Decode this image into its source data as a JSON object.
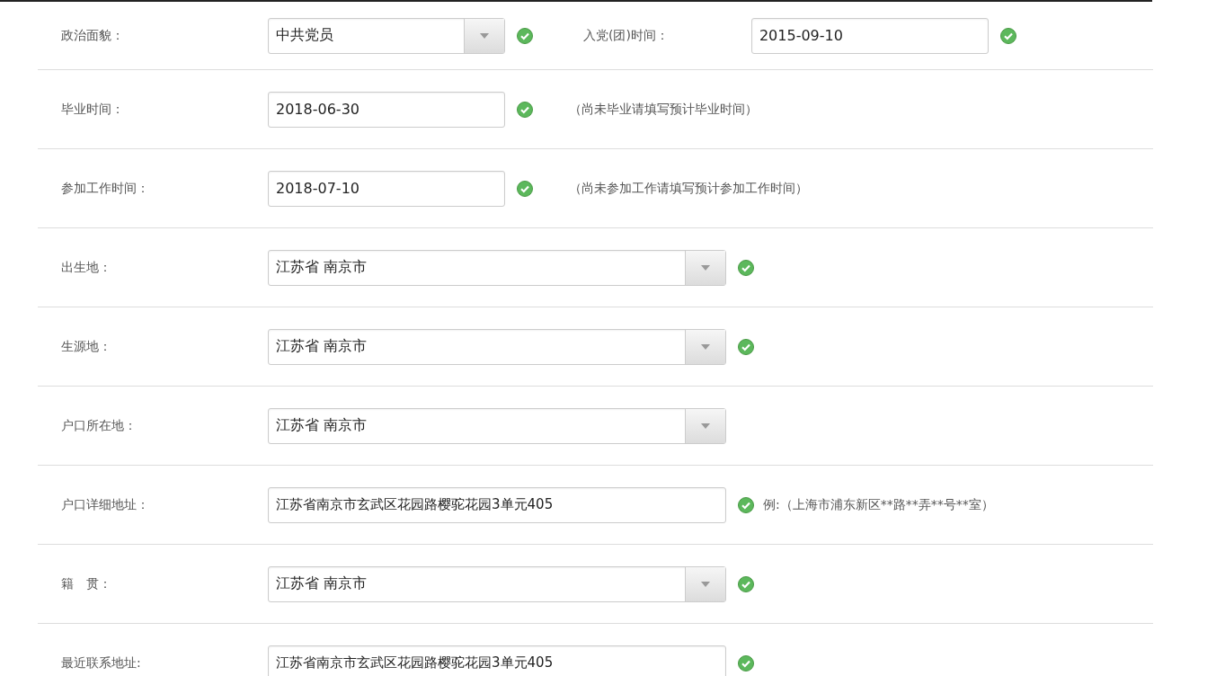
{
  "rows": [
    {
      "fields": [
        {
          "label": "政治面貌：",
          "kind": "select",
          "value": "中共党员",
          "valid": true
        },
        {
          "label": "入党(团)时间：",
          "kind": "date",
          "value": "2015-09-10",
          "valid": true
        }
      ]
    },
    {
      "fields": [
        {
          "label": "毕业时间：",
          "kind": "date",
          "value": "2018-06-30",
          "valid": true,
          "hint": "（尚未毕业请填写预计毕业时间）"
        }
      ]
    },
    {
      "fields": [
        {
          "label": "参加工作时间：",
          "kind": "date",
          "value": "2018-07-10",
          "valid": true,
          "hint": "（尚未参加工作请填写预计参加工作时间）"
        }
      ]
    },
    {
      "fields": [
        {
          "label": "出生地：",
          "kind": "select",
          "value": "江苏省 南京市",
          "valid": true
        }
      ]
    },
    {
      "fields": [
        {
          "label": "生源地：",
          "kind": "select",
          "value": "江苏省 南京市",
          "valid": true
        }
      ]
    },
    {
      "fields": [
        {
          "label": "户口所在地：",
          "kind": "select",
          "value": "江苏省 南京市",
          "valid": false
        }
      ]
    },
    {
      "fields": [
        {
          "label": "户口详细地址：",
          "kind": "text",
          "value": "江苏省南京市玄武区花园路樱驼花园3单元405",
          "valid": true,
          "hint": "例:（上海市浦东新区**路**弄**号**室）"
        }
      ]
    },
    {
      "fields": [
        {
          "label": "籍　贯：",
          "kind": "select",
          "value": "江苏省 南京市",
          "valid": true
        }
      ]
    },
    {
      "fields": [
        {
          "label": "最近联系地址:",
          "kind": "text",
          "value": "江苏省南京市玄武区花园路樱驼花园3单元405",
          "valid": true
        }
      ]
    }
  ]
}
